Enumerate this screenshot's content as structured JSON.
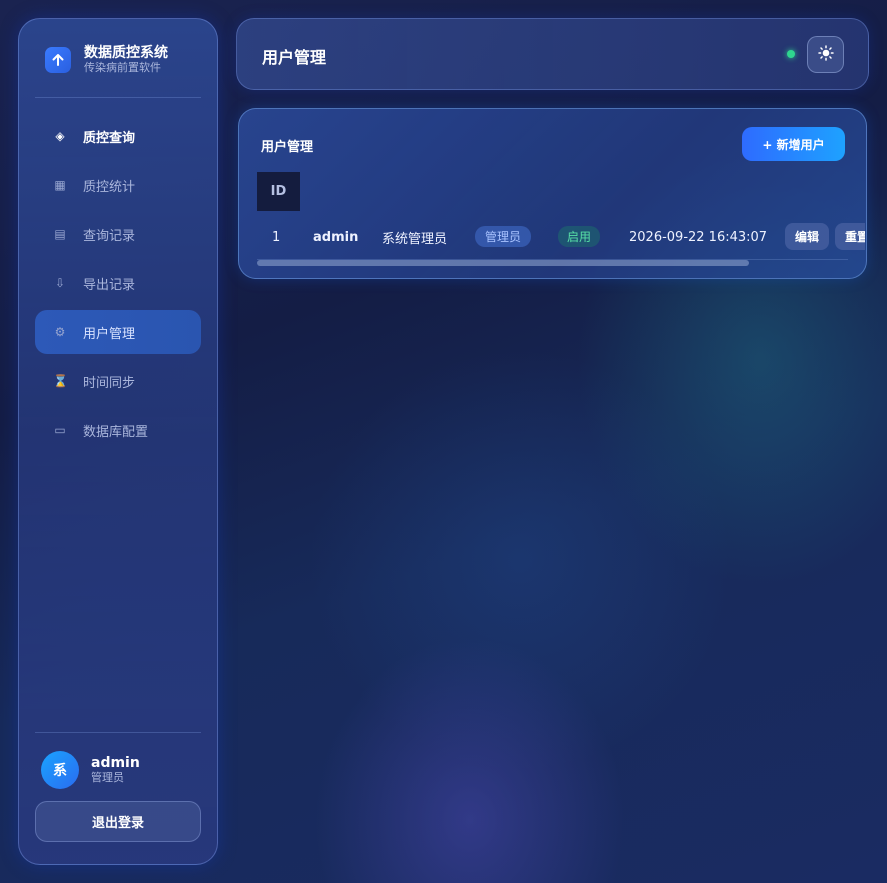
{
  "brand": {
    "title": "数据质控系统",
    "subtitle": "传染病前置软件",
    "logo_icon": "arrow-up-icon"
  },
  "sidebar": {
    "items": [
      {
        "label": "质控查询",
        "icon": "diamond-icon",
        "glyph": "◈"
      },
      {
        "label": "质控统计",
        "icon": "grid-icon",
        "glyph": "▦"
      },
      {
        "label": "查询记录",
        "icon": "list-icon",
        "glyph": "▤"
      },
      {
        "label": "导出记录",
        "icon": "download-arrow-icon",
        "glyph": "⇩"
      },
      {
        "label": "用户管理",
        "icon": "gear-icon",
        "glyph": "⚙"
      },
      {
        "label": "时间同步",
        "icon": "hourglass-icon",
        "glyph": "⌛"
      },
      {
        "label": "数据库配置",
        "icon": "database-icon",
        "glyph": "▭"
      }
    ],
    "active_index": 4
  },
  "user": {
    "avatar_text": "系",
    "name": "admin",
    "role": "管理员",
    "logout_label": "退出登录"
  },
  "header": {
    "title": "用户管理",
    "status_color": "#2fd68f",
    "theme_icon": "sun-icon"
  },
  "card": {
    "title": "用户管理",
    "add_button_label": "+ 新增用户",
    "column_header_id": "ID",
    "rows": [
      {
        "id": "1",
        "username": "admin",
        "display_name": "系统管理员",
        "role": "管理员",
        "status": "启用",
        "created_at": "2026-09-22 16:43:07",
        "edit_label": "编辑",
        "more_label": "重置"
      }
    ]
  },
  "colors": {
    "accent": "#2e6bff",
    "success": "#57e0a6",
    "background": "#141d45"
  }
}
